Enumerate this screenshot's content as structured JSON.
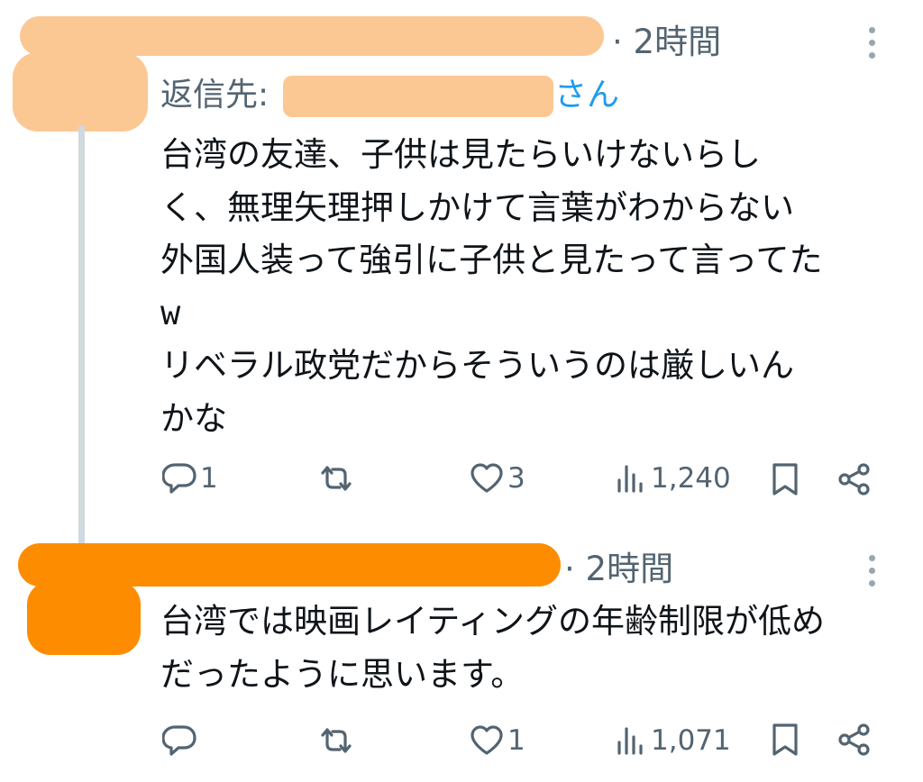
{
  "tweets": [
    {
      "time": "· 2時間",
      "reply_prefix": "返信先:",
      "reply_suffix": "さん",
      "text": "台湾の友達、子供は見たらいけないらし\nく、無理矢理押しかけて言葉がわからない\n外国人装って強引に子供と見たって言ってた\nw\nリベラル政党だからそういうのは厳しいん\nかな",
      "actions": {
        "reply_count": "1",
        "retweet_count": "",
        "like_count": "3",
        "views_count": "1,240"
      }
    },
    {
      "time": "· 2時間",
      "text": "台湾では映画レイティングの年齢制限が低め\nだったように思います。",
      "actions": {
        "reply_count": "",
        "retweet_count": "",
        "like_count": "1",
        "views_count": "1,071"
      }
    }
  ],
  "colors": {
    "text": "#0f1419",
    "secondary": "#536471",
    "link": "#1d9bf0",
    "thread_line": "#cfd9de",
    "redaction_light": "#fbc894",
    "redaction_dark": "#fd8c00"
  },
  "icons": [
    "reply-icon",
    "retweet-icon",
    "like-icon",
    "views-icon",
    "bookmark-icon",
    "share-icon",
    "more-icon"
  ]
}
